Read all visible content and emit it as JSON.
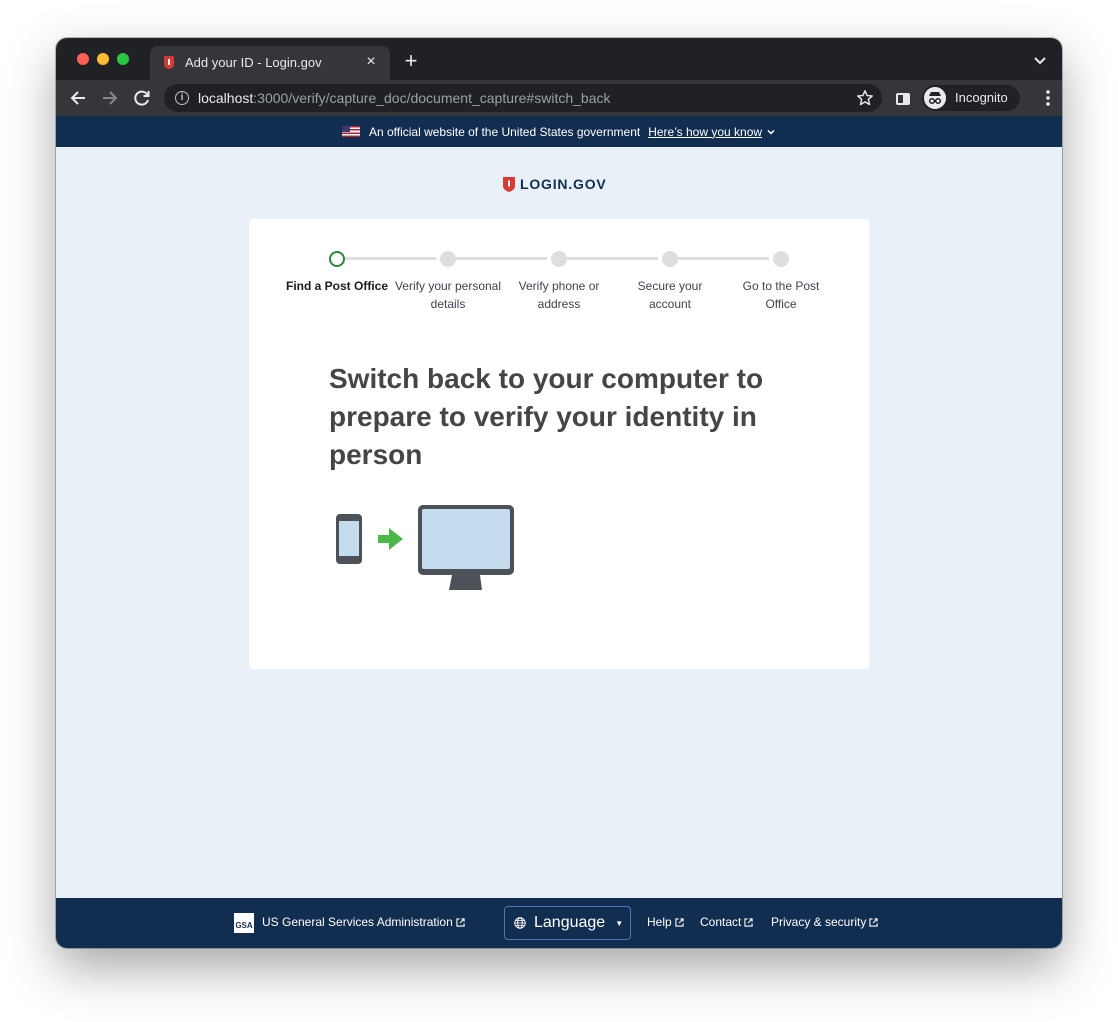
{
  "browser": {
    "tab_title": "Add your ID - Login.gov",
    "tab_close": "×",
    "new_tab": "+",
    "url_host": "localhost",
    "url_rest": ":3000/verify/capture_doc/document_capture#switch_back",
    "info_icon": "i",
    "profile_label": "Incognito"
  },
  "gov_banner": {
    "text": "An official website of the United States government",
    "link": "Here’s how you know"
  },
  "logo": {
    "text": "LOGIN.GOV"
  },
  "stepper": {
    "steps": [
      {
        "label": "Find a Post Office",
        "state": "current"
      },
      {
        "label": "Verify your personal details",
        "state": "upcoming"
      },
      {
        "label": "Verify phone or address",
        "state": "upcoming"
      },
      {
        "label": "Secure your account",
        "state": "upcoming"
      },
      {
        "label": "Go to the Post Office",
        "state": "upcoming"
      }
    ]
  },
  "main": {
    "heading": "Switch back to your computer to prepare to verify your identity in person"
  },
  "footer": {
    "gsa_logo": "GSA",
    "agency": "US General Services Administration",
    "language": "Language",
    "caret": "▼",
    "help": "Help",
    "contact": "Contact",
    "privacy": "Privacy & security"
  },
  "colors": {
    "navy": "#112e51",
    "page_bg": "#e9f0f8",
    "step_current": "#2e8540",
    "arrow_green": "#4cb849",
    "brand_red": "#d83933"
  }
}
